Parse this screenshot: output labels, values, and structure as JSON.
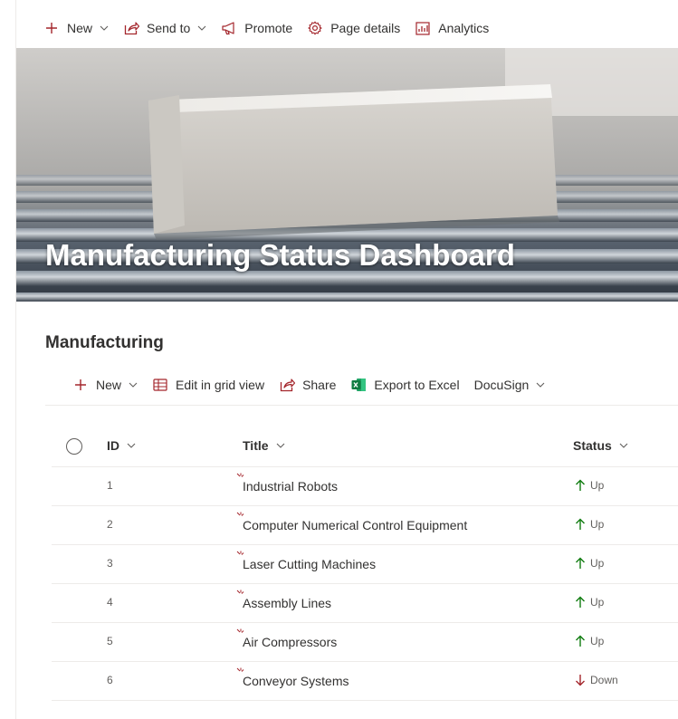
{
  "command_bar": {
    "new_label": "New",
    "send_to_label": "Send to",
    "promote_label": "Promote",
    "page_details_label": "Page details",
    "analytics_label": "Analytics"
  },
  "hero": {
    "title": "Manufacturing Status Dashboard"
  },
  "list": {
    "title": "Manufacturing",
    "toolbar": {
      "new_label": "New",
      "edit_grid_label": "Edit in grid view",
      "share_label": "Share",
      "export_label": "Export to Excel",
      "docusign_label": "DocuSign"
    },
    "columns": {
      "id": "ID",
      "title": "Title",
      "status": "Status"
    },
    "rows": [
      {
        "id": "1",
        "title": "Industrial Robots",
        "status": "Up"
      },
      {
        "id": "2",
        "title": "Computer Numerical Control Equipment",
        "status": "Up"
      },
      {
        "id": "3",
        "title": "Laser Cutting Machines",
        "status": "Up"
      },
      {
        "id": "4",
        "title": "Assembly Lines",
        "status": "Up"
      },
      {
        "id": "5",
        "title": "Air Compressors",
        "status": "Up"
      },
      {
        "id": "6",
        "title": "Conveyor Systems",
        "status": "Down"
      }
    ]
  },
  "colors": {
    "accent": "#a4262c",
    "up": "#107c10",
    "down": "#a4262c",
    "excel": "#217346"
  },
  "icons": [
    "plus-icon",
    "chevron-down-icon",
    "share-icon",
    "megaphone-icon",
    "gear-icon",
    "analytics-icon",
    "grid-icon",
    "excel-icon",
    "arrow-up-icon",
    "arrow-down-icon",
    "new-item-icon"
  ]
}
